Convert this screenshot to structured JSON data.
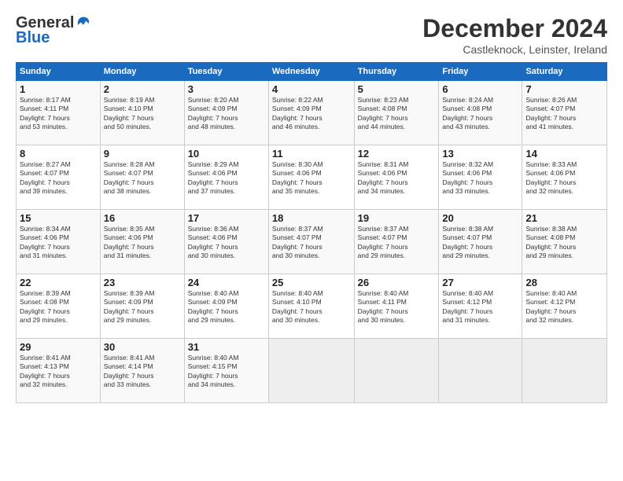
{
  "header": {
    "logo_general": "General",
    "logo_blue": "Blue",
    "month_title": "December 2024",
    "subtitle": "Castleknock, Leinster, Ireland"
  },
  "days_of_week": [
    "Sunday",
    "Monday",
    "Tuesday",
    "Wednesday",
    "Thursday",
    "Friday",
    "Saturday"
  ],
  "weeks": [
    [
      {
        "day": "1",
        "info": "Sunrise: 8:17 AM\nSunset: 4:11 PM\nDaylight: 7 hours\nand 53 minutes."
      },
      {
        "day": "2",
        "info": "Sunrise: 8:19 AM\nSunset: 4:10 PM\nDaylight: 7 hours\nand 50 minutes."
      },
      {
        "day": "3",
        "info": "Sunrise: 8:20 AM\nSunset: 4:09 PM\nDaylight: 7 hours\nand 48 minutes."
      },
      {
        "day": "4",
        "info": "Sunrise: 8:22 AM\nSunset: 4:09 PM\nDaylight: 7 hours\nand 46 minutes."
      },
      {
        "day": "5",
        "info": "Sunrise: 8:23 AM\nSunset: 4:08 PM\nDaylight: 7 hours\nand 44 minutes."
      },
      {
        "day": "6",
        "info": "Sunrise: 8:24 AM\nSunset: 4:08 PM\nDaylight: 7 hours\nand 43 minutes."
      },
      {
        "day": "7",
        "info": "Sunrise: 8:26 AM\nSunset: 4:07 PM\nDaylight: 7 hours\nand 41 minutes."
      }
    ],
    [
      {
        "day": "8",
        "info": "Sunrise: 8:27 AM\nSunset: 4:07 PM\nDaylight: 7 hours\nand 39 minutes."
      },
      {
        "day": "9",
        "info": "Sunrise: 8:28 AM\nSunset: 4:07 PM\nDaylight: 7 hours\nand 38 minutes."
      },
      {
        "day": "10",
        "info": "Sunrise: 8:29 AM\nSunset: 4:06 PM\nDaylight: 7 hours\nand 37 minutes."
      },
      {
        "day": "11",
        "info": "Sunrise: 8:30 AM\nSunset: 4:06 PM\nDaylight: 7 hours\nand 35 minutes."
      },
      {
        "day": "12",
        "info": "Sunrise: 8:31 AM\nSunset: 4:06 PM\nDaylight: 7 hours\nand 34 minutes."
      },
      {
        "day": "13",
        "info": "Sunrise: 8:32 AM\nSunset: 4:06 PM\nDaylight: 7 hours\nand 33 minutes."
      },
      {
        "day": "14",
        "info": "Sunrise: 8:33 AM\nSunset: 4:06 PM\nDaylight: 7 hours\nand 32 minutes."
      }
    ],
    [
      {
        "day": "15",
        "info": "Sunrise: 8:34 AM\nSunset: 4:06 PM\nDaylight: 7 hours\nand 31 minutes."
      },
      {
        "day": "16",
        "info": "Sunrise: 8:35 AM\nSunset: 4:06 PM\nDaylight: 7 hours\nand 31 minutes."
      },
      {
        "day": "17",
        "info": "Sunrise: 8:36 AM\nSunset: 4:06 PM\nDaylight: 7 hours\nand 30 minutes."
      },
      {
        "day": "18",
        "info": "Sunrise: 8:37 AM\nSunset: 4:07 PM\nDaylight: 7 hours\nand 30 minutes."
      },
      {
        "day": "19",
        "info": "Sunrise: 8:37 AM\nSunset: 4:07 PM\nDaylight: 7 hours\nand 29 minutes."
      },
      {
        "day": "20",
        "info": "Sunrise: 8:38 AM\nSunset: 4:07 PM\nDaylight: 7 hours\nand 29 minutes."
      },
      {
        "day": "21",
        "info": "Sunrise: 8:38 AM\nSunset: 4:08 PM\nDaylight: 7 hours\nand 29 minutes."
      }
    ],
    [
      {
        "day": "22",
        "info": "Sunrise: 8:39 AM\nSunset: 4:08 PM\nDaylight: 7 hours\nand 29 minutes."
      },
      {
        "day": "23",
        "info": "Sunrise: 8:39 AM\nSunset: 4:09 PM\nDaylight: 7 hours\nand 29 minutes."
      },
      {
        "day": "24",
        "info": "Sunrise: 8:40 AM\nSunset: 4:09 PM\nDaylight: 7 hours\nand 29 minutes."
      },
      {
        "day": "25",
        "info": "Sunrise: 8:40 AM\nSunset: 4:10 PM\nDaylight: 7 hours\nand 30 minutes."
      },
      {
        "day": "26",
        "info": "Sunrise: 8:40 AM\nSunset: 4:11 PM\nDaylight: 7 hours\nand 30 minutes."
      },
      {
        "day": "27",
        "info": "Sunrise: 8:40 AM\nSunset: 4:12 PM\nDaylight: 7 hours\nand 31 minutes."
      },
      {
        "day": "28",
        "info": "Sunrise: 8:40 AM\nSunset: 4:12 PM\nDaylight: 7 hours\nand 32 minutes."
      }
    ],
    [
      {
        "day": "29",
        "info": "Sunrise: 8:41 AM\nSunset: 4:13 PM\nDaylight: 7 hours\nand 32 minutes."
      },
      {
        "day": "30",
        "info": "Sunrise: 8:41 AM\nSunset: 4:14 PM\nDaylight: 7 hours\nand 33 minutes."
      },
      {
        "day": "31",
        "info": "Sunrise: 8:40 AM\nSunset: 4:15 PM\nDaylight: 7 hours\nand 34 minutes."
      },
      {
        "day": "",
        "info": ""
      },
      {
        "day": "",
        "info": ""
      },
      {
        "day": "",
        "info": ""
      },
      {
        "day": "",
        "info": ""
      }
    ]
  ]
}
